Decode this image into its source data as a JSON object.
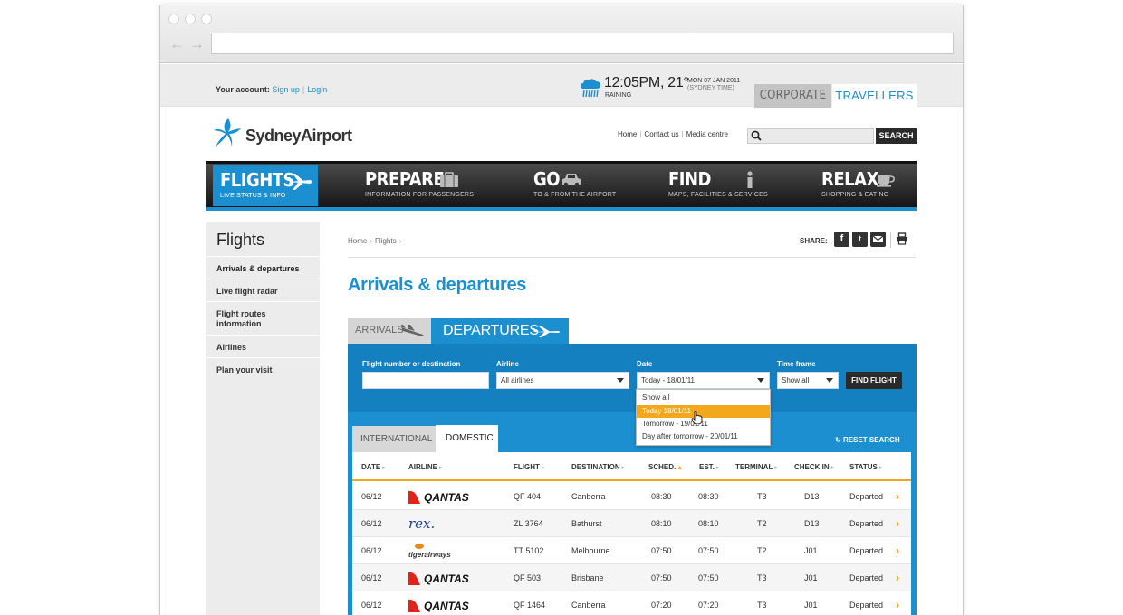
{
  "account": {
    "label": "Your account:",
    "signup": "Sign up",
    "login": "Login"
  },
  "weather": {
    "time_temp": "12:05PM, 21°",
    "condition": "RAINING",
    "date": "MON 07 JAN 2011",
    "zone": "(SYDNEY TIME)"
  },
  "audience_tabs": {
    "corporate": "CORPORATE",
    "travellers": "TRAVELLERS"
  },
  "logo": {
    "text": "SydneyAirport"
  },
  "toplinks": [
    "Home",
    "Contact us",
    "Media centre"
  ],
  "search": {
    "placeholder": "",
    "button": "SEARCH"
  },
  "mainnav": [
    {
      "title": "FLIGHTS",
      "sub": "LIVE STATUS & INFO",
      "icon": "plane-icon",
      "active": true
    },
    {
      "title": "PREPARE",
      "sub": "INFORMATION FOR PASSENGERS",
      "icon": "suitcase-icon"
    },
    {
      "title": "GO",
      "sub": "TO & FROM THE AIRPORT",
      "icon": "car-icon"
    },
    {
      "title": "FIND",
      "sub": "MAPS, FACILITIES & SERVICES",
      "icon": "info-icon"
    },
    {
      "title": "RELAX",
      "sub": "SHOPPING & EATING",
      "icon": "cup-icon"
    }
  ],
  "sidebar": {
    "title": "Flights",
    "items": [
      "Arrivals & departures",
      "Live flight radar",
      "Flight routes information",
      "Airlines",
      "Plan your visit"
    ]
  },
  "breadcrumb": [
    "Home",
    "Flights"
  ],
  "share": {
    "label": "SHARE:"
  },
  "page_title": "Arrivals & departures",
  "tabs": {
    "arrivals": "ARRIVALS",
    "departures": "DEPARTURES"
  },
  "filters": {
    "flight_label": "Flight number or destination",
    "flight_value": "",
    "airline_label": "Airline",
    "airline_value": "All airlines",
    "date_label": "Date",
    "date_value": "Today - 18/01/11",
    "timeframe_label": "Time frame",
    "timeframe_value": "Show all",
    "find_button": "FIND FLIGHT"
  },
  "date_options": [
    "Show all",
    "Today 18/01/11",
    "Tomorrow - 19/01/11",
    "Day after tomorrow - 20/01/11"
  ],
  "subtabs": {
    "international": "INTERNATIONAL",
    "domestic": "DOMESTIC"
  },
  "reset": "RESET SEARCH",
  "columns": [
    "DATE",
    "AIRLINE",
    "FLIGHT",
    "DESTINATION",
    "SCHED.",
    "EST.",
    "TERMINAL",
    "CHECK IN",
    "STATUS"
  ],
  "rows": [
    {
      "date": "06/12",
      "airline": "QANTAS",
      "flight": "QF 404",
      "destination": "Canberra",
      "sched": "08:30",
      "est": "08:30",
      "terminal": "T3",
      "checkin": "D13",
      "status": "Departed"
    },
    {
      "date": "06/12",
      "airline": "rex.",
      "flight": "ZL 3764",
      "destination": "Bathurst",
      "sched": "08:10",
      "est": "08:10",
      "terminal": "T2",
      "checkin": "D13",
      "status": "Departed"
    },
    {
      "date": "06/12",
      "airline": "tigerairways",
      "flight": "TT 5102",
      "destination": "Melbourne",
      "sched": "07:50",
      "est": "07:50",
      "terminal": "T2",
      "checkin": "J01",
      "status": "Departed"
    },
    {
      "date": "06/12",
      "airline": "QANTAS",
      "flight": "QF 503",
      "destination": "Brisbane",
      "sched": "07:50",
      "est": "07:50",
      "terminal": "T3",
      "checkin": "J01",
      "status": "Departed"
    },
    {
      "date": "06/12",
      "airline": "QANTAS",
      "flight": "QF 1464",
      "destination": "Canberra",
      "sched": "07:20",
      "est": "07:20",
      "terminal": "T3",
      "checkin": "J01",
      "status": "Departed"
    }
  ],
  "colors": {
    "accent": "#1b8fcf",
    "orange": "#f3a81c",
    "dark": "#2a2a2a",
    "qantas_red": "#e2231a"
  }
}
